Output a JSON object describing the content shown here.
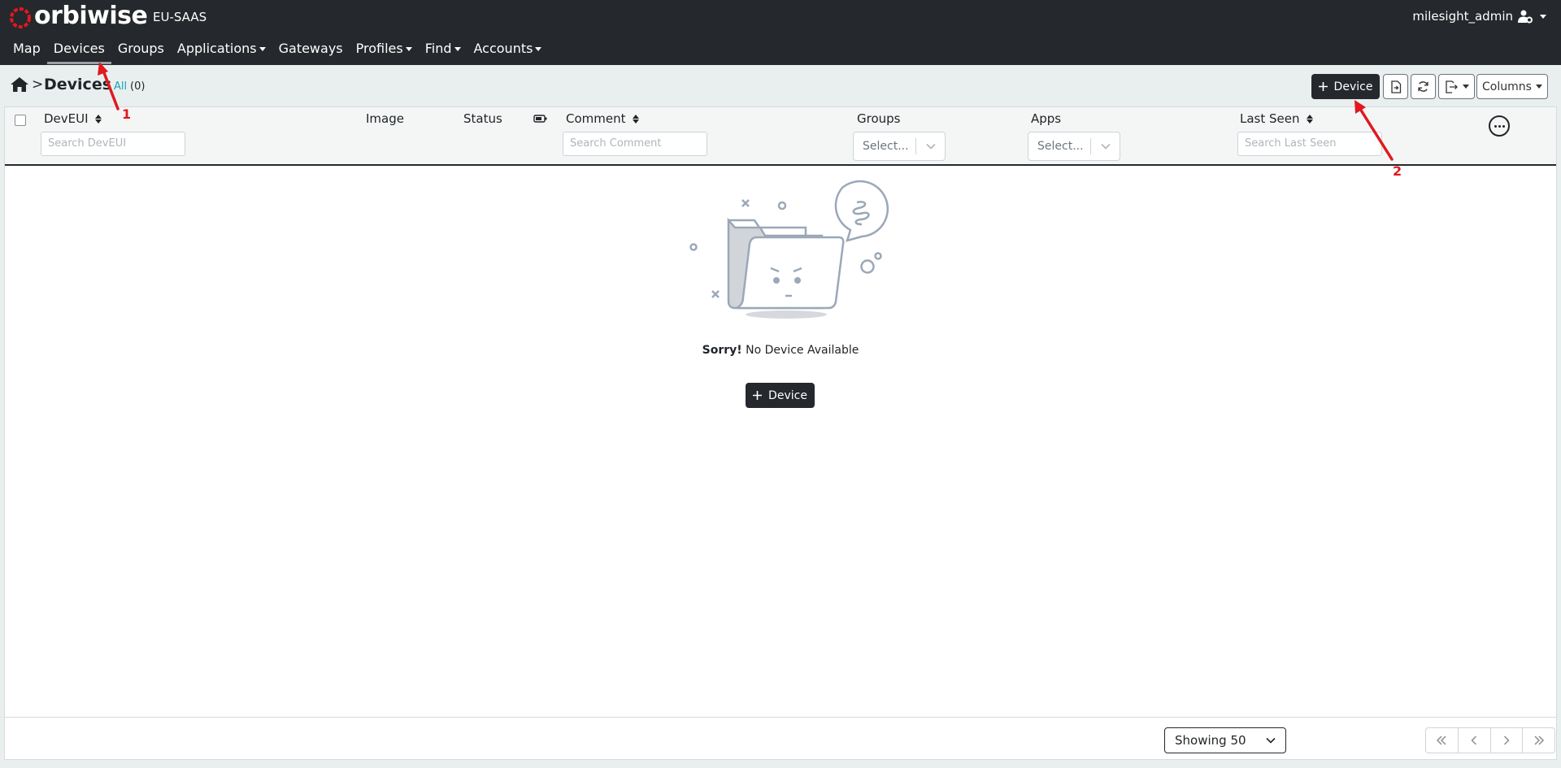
{
  "header": {
    "brand": "orbiwise",
    "tenant": "EU-SAAS",
    "user": "milesight_admin"
  },
  "nav": {
    "items": [
      {
        "label": "Map",
        "dropdown": false
      },
      {
        "label": "Devices",
        "dropdown": false
      },
      {
        "label": "Groups",
        "dropdown": false
      },
      {
        "label": "Applications",
        "dropdown": true
      },
      {
        "label": "Gateways",
        "dropdown": false
      },
      {
        "label": "Profiles",
        "dropdown": true
      },
      {
        "label": "Find",
        "dropdown": true
      },
      {
        "label": "Accounts",
        "dropdown": true
      }
    ],
    "active": "Devices"
  },
  "toolbar": {
    "breadcrumb_sep": ">",
    "title": "Devices",
    "filter_label": "All",
    "filter_count": "(0)",
    "add_label": "Device",
    "columns_label": "Columns"
  },
  "table": {
    "columns": {
      "deveui": "DevEUI",
      "image": "Image",
      "status": "Status",
      "comment": "Comment",
      "groups": "Groups",
      "apps": "Apps",
      "last_seen": "Last Seen"
    },
    "placeholders": {
      "deveui": "Search DevEUI",
      "comment": "Search Comment",
      "groups": "Select...",
      "apps": "Select...",
      "last_seen": "Search Last Seen"
    }
  },
  "empty": {
    "title": "Sorry!",
    "message": "No Device Available",
    "add_label": "Device"
  },
  "footer": {
    "page_size": "Showing 50"
  },
  "annotations": {
    "first": "1",
    "second": "2"
  },
  "colors": {
    "header_bg": "#25282c",
    "link": "#17a2b8",
    "annotation": "#e0191f",
    "brand_ring": "#e0191f"
  }
}
